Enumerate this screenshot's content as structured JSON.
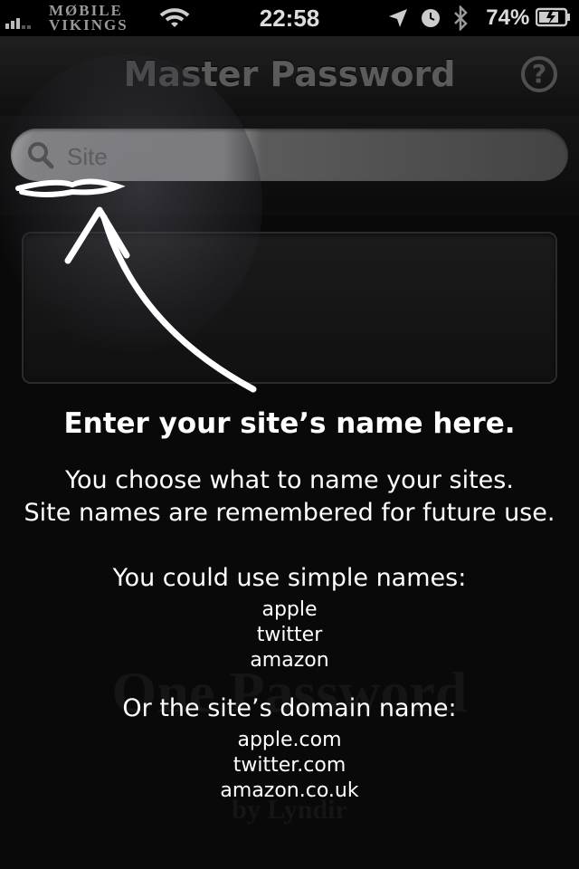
{
  "status_bar": {
    "carrier_line1": "MØBILE",
    "carrier_line2": "VIKINGS",
    "time": "22:58",
    "battery": "74%"
  },
  "nav": {
    "title": "Master Password",
    "help_label": "?"
  },
  "search": {
    "placeholder": "Site"
  },
  "watermark": {
    "line1": "One Password",
    "line2": "by Lyndir"
  },
  "hint": {
    "heading": "Enter your site’s name here.",
    "line1": "You choose what to name your sites.",
    "line2": "Site names are remembered for future use.",
    "simple_heading": "You could use simple names:",
    "simple_examples": [
      "apple",
      "twitter",
      "amazon"
    ],
    "domain_heading": "Or the site’s domain name:",
    "domain_examples": [
      "apple.com",
      "twitter.com",
      "amazon.co.uk"
    ]
  },
  "icons": [
    "signal-icon",
    "wifi-icon",
    "location-icon",
    "alarm-icon",
    "bluetooth-icon",
    "battery-icon",
    "search-icon",
    "help-icon",
    "arrow-icon"
  ]
}
